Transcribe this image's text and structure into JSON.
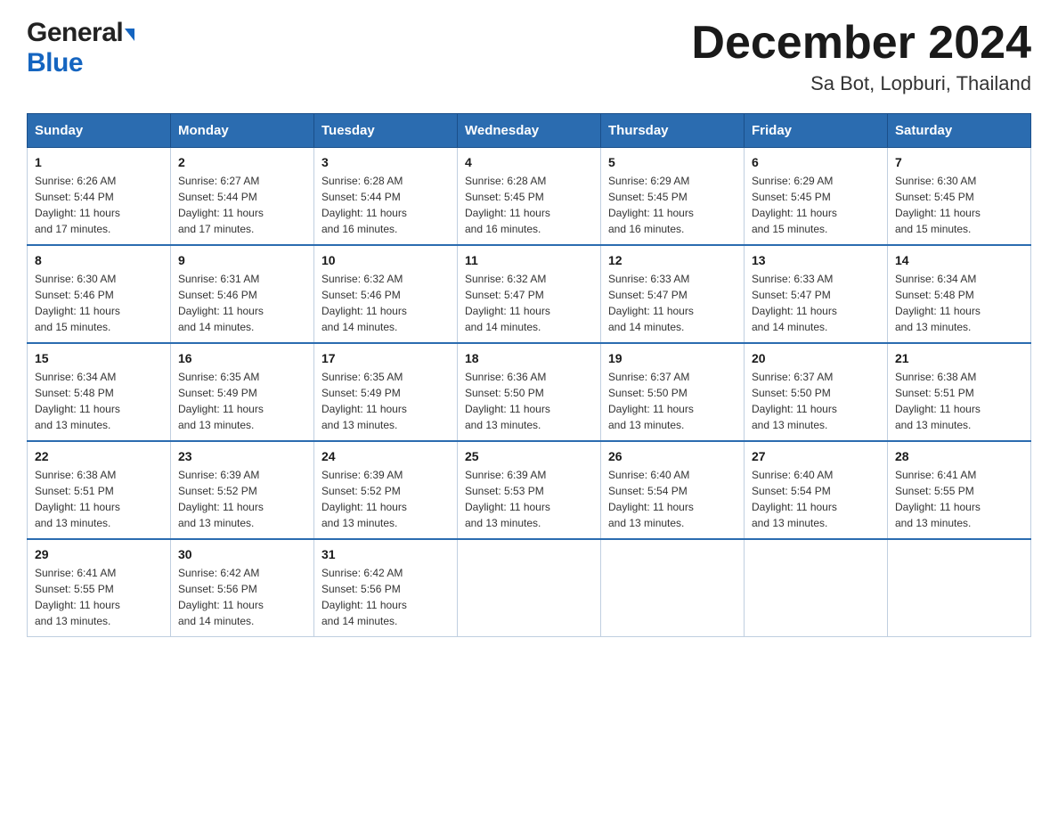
{
  "header": {
    "logo_general": "General",
    "logo_blue": "Blue",
    "title": "December 2024",
    "subtitle": "Sa Bot, Lopburi, Thailand"
  },
  "days_of_week": [
    "Sunday",
    "Monday",
    "Tuesday",
    "Wednesday",
    "Thursday",
    "Friday",
    "Saturday"
  ],
  "weeks": [
    [
      {
        "day": "1",
        "sunrise": "6:26 AM",
        "sunset": "5:44 PM",
        "daylight": "11 hours and 17 minutes."
      },
      {
        "day": "2",
        "sunrise": "6:27 AM",
        "sunset": "5:44 PM",
        "daylight": "11 hours and 17 minutes."
      },
      {
        "day": "3",
        "sunrise": "6:28 AM",
        "sunset": "5:44 PM",
        "daylight": "11 hours and 16 minutes."
      },
      {
        "day": "4",
        "sunrise": "6:28 AM",
        "sunset": "5:45 PM",
        "daylight": "11 hours and 16 minutes."
      },
      {
        "day": "5",
        "sunrise": "6:29 AM",
        "sunset": "5:45 PM",
        "daylight": "11 hours and 16 minutes."
      },
      {
        "day": "6",
        "sunrise": "6:29 AM",
        "sunset": "5:45 PM",
        "daylight": "11 hours and 15 minutes."
      },
      {
        "day": "7",
        "sunrise": "6:30 AM",
        "sunset": "5:45 PM",
        "daylight": "11 hours and 15 minutes."
      }
    ],
    [
      {
        "day": "8",
        "sunrise": "6:30 AM",
        "sunset": "5:46 PM",
        "daylight": "11 hours and 15 minutes."
      },
      {
        "day": "9",
        "sunrise": "6:31 AM",
        "sunset": "5:46 PM",
        "daylight": "11 hours and 14 minutes."
      },
      {
        "day": "10",
        "sunrise": "6:32 AM",
        "sunset": "5:46 PM",
        "daylight": "11 hours and 14 minutes."
      },
      {
        "day": "11",
        "sunrise": "6:32 AM",
        "sunset": "5:47 PM",
        "daylight": "11 hours and 14 minutes."
      },
      {
        "day": "12",
        "sunrise": "6:33 AM",
        "sunset": "5:47 PM",
        "daylight": "11 hours and 14 minutes."
      },
      {
        "day": "13",
        "sunrise": "6:33 AM",
        "sunset": "5:47 PM",
        "daylight": "11 hours and 14 minutes."
      },
      {
        "day": "14",
        "sunrise": "6:34 AM",
        "sunset": "5:48 PM",
        "daylight": "11 hours and 13 minutes."
      }
    ],
    [
      {
        "day": "15",
        "sunrise": "6:34 AM",
        "sunset": "5:48 PM",
        "daylight": "11 hours and 13 minutes."
      },
      {
        "day": "16",
        "sunrise": "6:35 AM",
        "sunset": "5:49 PM",
        "daylight": "11 hours and 13 minutes."
      },
      {
        "day": "17",
        "sunrise": "6:35 AM",
        "sunset": "5:49 PM",
        "daylight": "11 hours and 13 minutes."
      },
      {
        "day": "18",
        "sunrise": "6:36 AM",
        "sunset": "5:50 PM",
        "daylight": "11 hours and 13 minutes."
      },
      {
        "day": "19",
        "sunrise": "6:37 AM",
        "sunset": "5:50 PM",
        "daylight": "11 hours and 13 minutes."
      },
      {
        "day": "20",
        "sunrise": "6:37 AM",
        "sunset": "5:50 PM",
        "daylight": "11 hours and 13 minutes."
      },
      {
        "day": "21",
        "sunrise": "6:38 AM",
        "sunset": "5:51 PM",
        "daylight": "11 hours and 13 minutes."
      }
    ],
    [
      {
        "day": "22",
        "sunrise": "6:38 AM",
        "sunset": "5:51 PM",
        "daylight": "11 hours and 13 minutes."
      },
      {
        "day": "23",
        "sunrise": "6:39 AM",
        "sunset": "5:52 PM",
        "daylight": "11 hours and 13 minutes."
      },
      {
        "day": "24",
        "sunrise": "6:39 AM",
        "sunset": "5:52 PM",
        "daylight": "11 hours and 13 minutes."
      },
      {
        "day": "25",
        "sunrise": "6:39 AM",
        "sunset": "5:53 PM",
        "daylight": "11 hours and 13 minutes."
      },
      {
        "day": "26",
        "sunrise": "6:40 AM",
        "sunset": "5:54 PM",
        "daylight": "11 hours and 13 minutes."
      },
      {
        "day": "27",
        "sunrise": "6:40 AM",
        "sunset": "5:54 PM",
        "daylight": "11 hours and 13 minutes."
      },
      {
        "day": "28",
        "sunrise": "6:41 AM",
        "sunset": "5:55 PM",
        "daylight": "11 hours and 13 minutes."
      }
    ],
    [
      {
        "day": "29",
        "sunrise": "6:41 AM",
        "sunset": "5:55 PM",
        "daylight": "11 hours and 13 minutes."
      },
      {
        "day": "30",
        "sunrise": "6:42 AM",
        "sunset": "5:56 PM",
        "daylight": "11 hours and 14 minutes."
      },
      {
        "day": "31",
        "sunrise": "6:42 AM",
        "sunset": "5:56 PM",
        "daylight": "11 hours and 14 minutes."
      },
      null,
      null,
      null,
      null
    ]
  ],
  "labels": {
    "sunrise": "Sunrise:",
    "sunset": "Sunset:",
    "daylight": "Daylight:"
  }
}
